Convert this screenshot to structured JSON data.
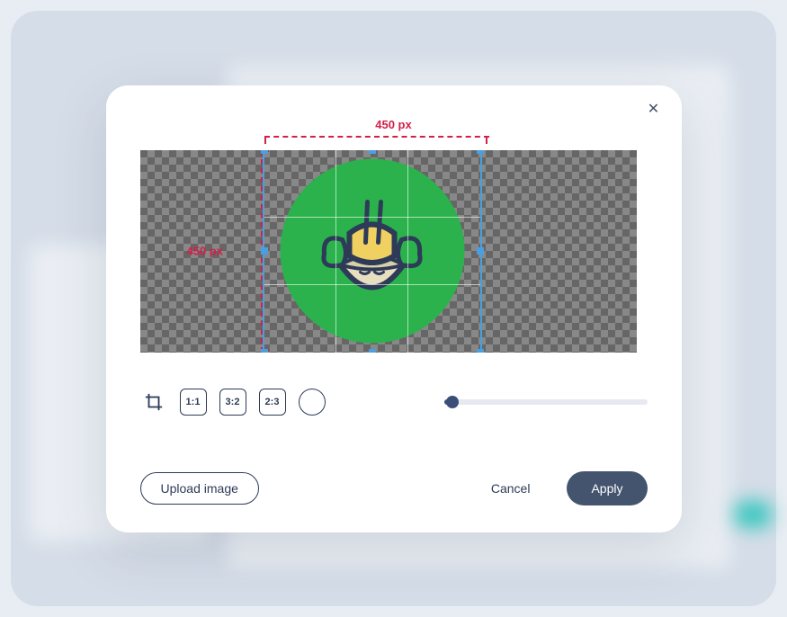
{
  "modal": {
    "close_label": "✕",
    "canvas": {
      "width_label": "450 px",
      "height_label": "450 px"
    },
    "toolbar": {
      "ratios": [
        "1:1",
        "3:2",
        "2:3"
      ],
      "zoom_percent": 4
    },
    "footer": {
      "upload": "Upload image",
      "cancel": "Cancel",
      "apply": "Apply"
    }
  }
}
